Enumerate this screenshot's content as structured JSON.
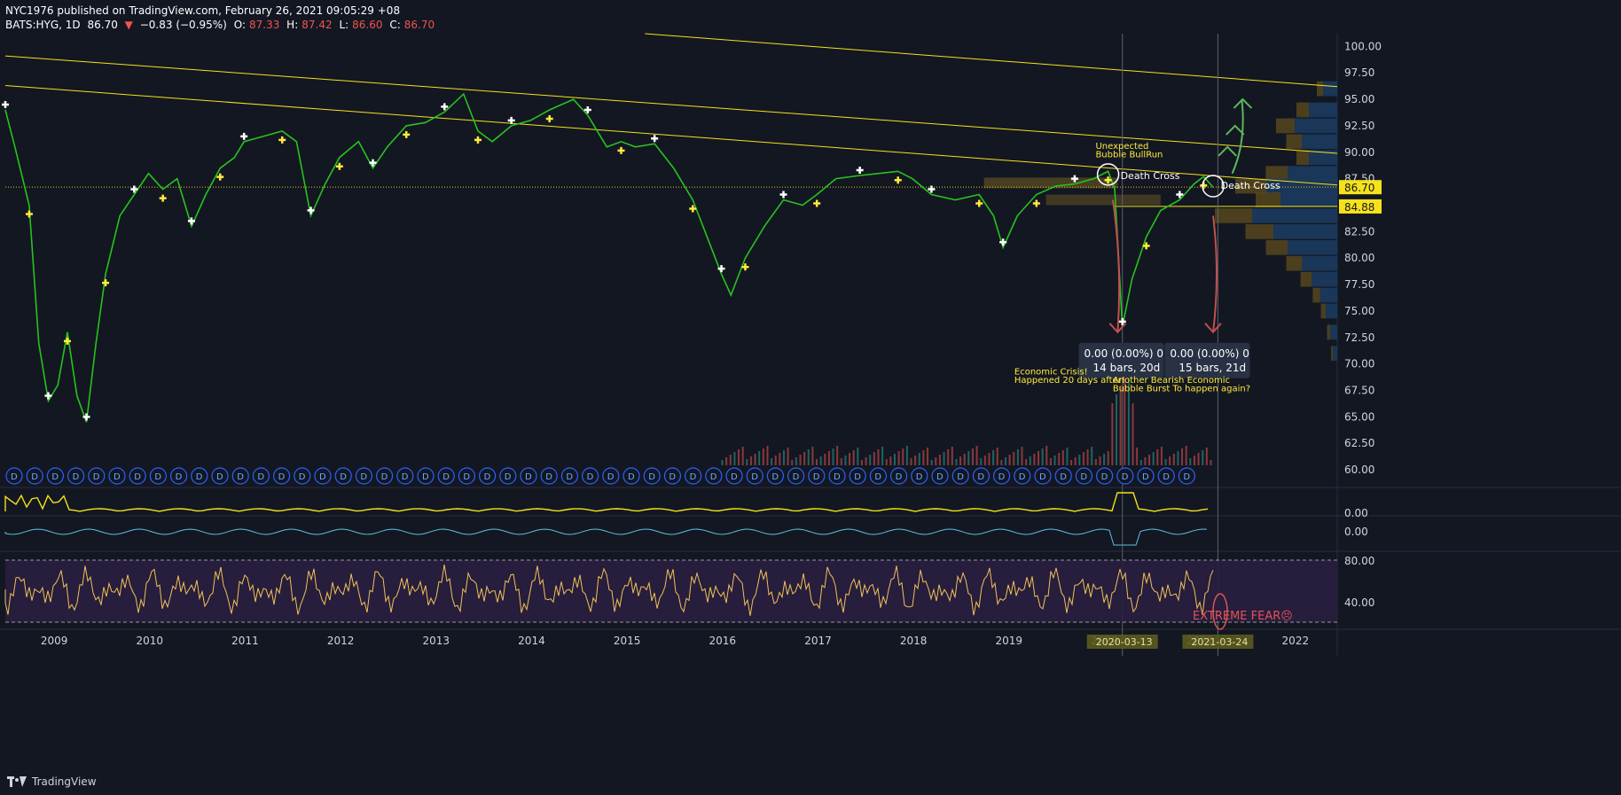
{
  "header": {
    "line1": "NYC1976 published on TradingView.com, February 26, 2021 09:05:29 +08",
    "symbol": "BATS:HYG, 1D",
    "last": "86.70",
    "change": "−0.83 (−0.95%)",
    "open_label": "O:",
    "open": "87.33",
    "high_label": "H:",
    "high": "87.42",
    "low_label": "L:",
    "low": "86.60",
    "close_label": "C:",
    "close": "86.70"
  },
  "footer": {
    "brand": "TradingView"
  },
  "colors": {
    "background": "#131722",
    "up": "#26a69a",
    "down": "#ef5350",
    "price_line": "#27c21f",
    "trendline": "#f5e21b",
    "rsi_line": "#f0c25a",
    "rsi_band": "#2a1e3f",
    "volume_profile_up": "#1c3a5e",
    "volume_profile_down": "#5a4a1e",
    "annotation_yellow": "#ffeb3b",
    "arrow_red": "#c0504d",
    "arrow_green": "#5cb85c"
  },
  "chart_data": {
    "type": "line",
    "title": "",
    "xlabel": "",
    "ylabel": "",
    "x_ticks": [
      "2009",
      "2010",
      "2011",
      "2012",
      "2013",
      "2014",
      "2015",
      "2016",
      "2017",
      "2018",
      "2019",
      "2020",
      "2021",
      "2022"
    ],
    "x_range": [
      2008.5,
      2022.45
    ],
    "y_ticks": [
      "100.00",
      "97.50",
      "95.00",
      "92.50",
      "90.00",
      "87.50",
      "85.00",
      "82.50",
      "80.00",
      "77.50",
      "75.00",
      "72.50",
      "70.00",
      "67.50",
      "65.00",
      "62.50",
      "60.00"
    ],
    "ylim": [
      58.5,
      101.2
    ],
    "grid": false,
    "series": [
      {
        "points": [
          [
            2008.5,
            94.0
          ],
          [
            2008.6,
            90.5
          ],
          [
            2008.75,
            85.0
          ],
          [
            2008.85,
            72.0
          ],
          [
            2008.95,
            66.5
          ],
          [
            2009.05,
            68.0
          ],
          [
            2009.15,
            73.0
          ],
          [
            2009.25,
            67.0
          ],
          [
            2009.35,
            64.5
          ],
          [
            2009.45,
            72.0
          ],
          [
            2009.55,
            78.5
          ],
          [
            2009.7,
            84.0
          ],
          [
            2009.85,
            86.0
          ],
          [
            2010.0,
            88.0
          ],
          [
            2010.15,
            86.5
          ],
          [
            2010.3,
            87.5
          ],
          [
            2010.45,
            83.0
          ],
          [
            2010.6,
            86.0
          ],
          [
            2010.75,
            88.5
          ],
          [
            2010.9,
            89.5
          ],
          [
            2011.0,
            91.0
          ],
          [
            2011.2,
            91.5
          ],
          [
            2011.4,
            92.0
          ],
          [
            2011.55,
            91.0
          ],
          [
            2011.7,
            84.0
          ],
          [
            2011.85,
            87.0
          ],
          [
            2012.0,
            89.5
          ],
          [
            2012.2,
            91.0
          ],
          [
            2012.35,
            88.5
          ],
          [
            2012.5,
            90.5
          ],
          [
            2012.7,
            92.5
          ],
          [
            2012.9,
            92.8
          ],
          [
            2013.1,
            93.8
          ],
          [
            2013.3,
            95.5
          ],
          [
            2013.45,
            92.0
          ],
          [
            2013.6,
            91.0
          ],
          [
            2013.8,
            92.5
          ],
          [
            2014.0,
            93.0
          ],
          [
            2014.2,
            94.0
          ],
          [
            2014.45,
            95.0
          ],
          [
            2014.6,
            93.5
          ],
          [
            2014.8,
            90.5
          ],
          [
            2014.95,
            91.0
          ],
          [
            2015.1,
            90.5
          ],
          [
            2015.3,
            90.8
          ],
          [
            2015.5,
            88.5
          ],
          [
            2015.7,
            85.5
          ],
          [
            2015.85,
            82.0
          ],
          [
            2016.0,
            78.5
          ],
          [
            2016.1,
            76.5
          ],
          [
            2016.25,
            80.0
          ],
          [
            2016.45,
            83.0
          ],
          [
            2016.65,
            85.5
          ],
          [
            2016.85,
            85.0
          ],
          [
            2017.0,
            86.0
          ],
          [
            2017.2,
            87.5
          ],
          [
            2017.45,
            87.8
          ],
          [
            2017.65,
            88.0
          ],
          [
            2017.85,
            88.2
          ],
          [
            2018.0,
            87.5
          ],
          [
            2018.2,
            86.0
          ],
          [
            2018.45,
            85.5
          ],
          [
            2018.7,
            86.0
          ],
          [
            2018.85,
            84.0
          ],
          [
            2018.95,
            81.0
          ],
          [
            2019.1,
            84.0
          ],
          [
            2019.3,
            86.0
          ],
          [
            2019.5,
            86.8
          ],
          [
            2019.7,
            87.0
          ],
          [
            2019.9,
            87.5
          ],
          [
            2020.05,
            88.2
          ],
          [
            2020.12,
            86.5
          ],
          [
            2020.2,
            73.5
          ],
          [
            2020.3,
            78.0
          ],
          [
            2020.45,
            82.0
          ],
          [
            2020.6,
            84.5
          ],
          [
            2020.8,
            85.5
          ],
          [
            2020.95,
            87.0
          ],
          [
            2021.05,
            87.7
          ],
          [
            2021.15,
            86.7
          ]
        ]
      }
    ],
    "pane_indicator_labels": {
      "pane2": "0.00",
      "pane3": "0.00",
      "rsi_upper": "80.00",
      "rsi_lower": "40.00"
    },
    "price_labels": [
      {
        "value": "86.70",
        "y": 86.7
      },
      {
        "value": "84.88",
        "y": 84.88
      }
    ],
    "annotations": [
      {
        "text": "Death Cross",
        "x": 2020.05,
        "y": 87.8
      },
      {
        "text": "Death Cross",
        "x": 2021.1,
        "y": 86.9
      },
      {
        "text": "Unexpected",
        "x": 2019.9,
        "y": 90.3
      },
      {
        "text": "Bubble BullRun",
        "x": 2019.9,
        "y": 89.5
      },
      {
        "text": "Economic Crisis!",
        "x": 2019.05,
        "y": 69.0
      },
      {
        "text": "Happened 20 days after!",
        "x": 2019.05,
        "y": 68.2
      },
      {
        "text": "Another Bearish Economic",
        "x": 2020.08,
        "y": 68.2
      },
      {
        "text": "Bubble Burst To happen again?",
        "x": 2020.08,
        "y": 67.4
      },
      {
        "text": "EXTREME FEAR😣",
        "x": 2020.8,
        "y": 0
      }
    ],
    "measure_boxes": [
      {
        "line1": "0.00 (0.00%) 0",
        "line2": "14 bars, 20d",
        "x": 2019.78,
        "y": 72.0
      },
      {
        "line1": "0.00 (0.00%) 0",
        "line2": "15 bars, 21d",
        "x": 2020.68,
        "y": 72.0
      }
    ],
    "date_labels": [
      {
        "text": "2020-03-13",
        "x": 2020.2
      },
      {
        "text": "2021-03-24",
        "x": 2021.2
      }
    ]
  }
}
